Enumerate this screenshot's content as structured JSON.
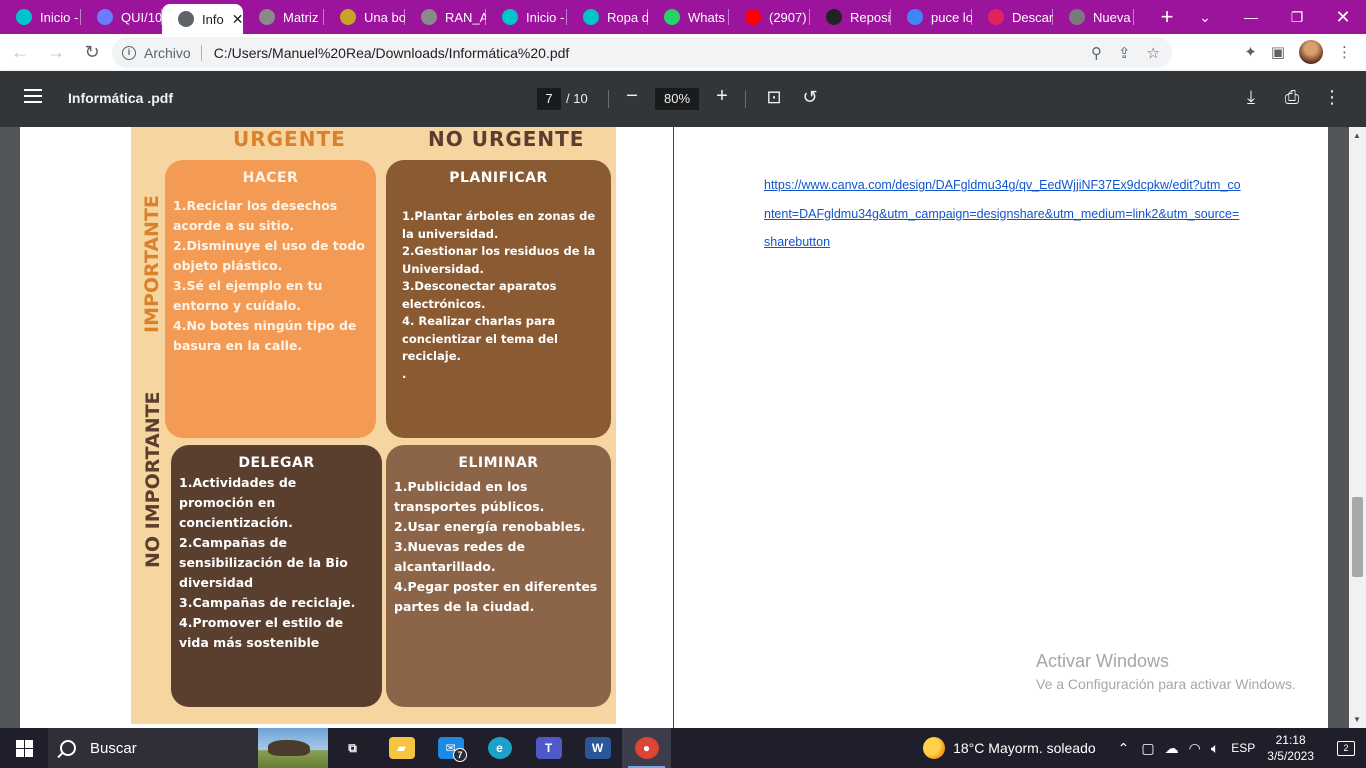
{
  "browser": {
    "tabs": [
      {
        "label": "Inicio -",
        "icon": "canva-icon",
        "color": "#00c4cc"
      },
      {
        "label": "QUI/10",
        "icon": "puzzle-icon",
        "color": "#6b7cff"
      },
      {
        "label": "Info",
        "icon": "chrome-doc-icon",
        "color": "#5f6368",
        "active": true
      },
      {
        "label": "Matriz",
        "icon": "site-icon",
        "color": "#8a8a8a"
      },
      {
        "label": "Una bo",
        "icon": "site-icon",
        "color": "#c9a227"
      },
      {
        "label": "RAN_A",
        "icon": "site-icon",
        "color": "#8a8a8a"
      },
      {
        "label": "Inicio -",
        "icon": "canva-icon",
        "color": "#00c4cc"
      },
      {
        "label": "Ropa d",
        "icon": "canva-icon",
        "color": "#00c4cc"
      },
      {
        "label": "Whats",
        "icon": "whatsapp-icon",
        "color": "#25d366"
      },
      {
        "label": "(2907)",
        "icon": "youtube-icon",
        "color": "#ff0000"
      },
      {
        "label": "Reposi",
        "icon": "d-icon",
        "color": "#222222"
      },
      {
        "label": "puce lo",
        "icon": "google-icon",
        "color": "#4285f4"
      },
      {
        "label": "Descar",
        "icon": "heart-icon",
        "color": "#e0245e"
      },
      {
        "label": "Nueva",
        "icon": "newtab-icon",
        "color": "#7a7a7a"
      }
    ],
    "address": {
      "security_label": "Archivo",
      "url": "C:/Users/Manuel%20Rea/Downloads/Informática%20.pdf"
    }
  },
  "pdf_toolbar": {
    "title": "Informática .pdf",
    "current_page": "7",
    "total_pages": "/ 10",
    "zoom": "80%"
  },
  "matrix": {
    "headers": {
      "urgent": "URGENTE",
      "not_urgent": "NO URGENTE"
    },
    "row_labels": {
      "important": "IMPORTANTE",
      "not_important": "NO IMPORTANTE"
    },
    "quadrants": {
      "hacer": {
        "title": "HACER",
        "items": [
          "1.Reciclar los desechos acorde a su sitio.",
          "2.Disminuye el uso de todo objeto plástico.",
          "3.Sé el ejemplo en tu entorno y cuídalo.",
          "4.No botes ningún tipo de basura en la calle."
        ]
      },
      "planificar": {
        "title": "PLANIFICAR",
        "items": [
          "1.Plantar árboles en zonas de la universidad.",
          "2.Gestionar los residuos de la Universidad.",
          "3.Desconectar aparatos electrónicos.",
          "4. Realizar charlas para concientizar el tema del reciclaje.",
          "."
        ]
      },
      "delegar": {
        "title": "DELEGAR",
        "items": [
          "1.Actividades de promoción en concientización.",
          "2.Campañas de sensibilización de la Bio diversidad",
          "3.Campañas de reciclaje.",
          "4.Promover el estilo de vida más sostenible"
        ]
      },
      "eliminar": {
        "title": "ELIMINAR",
        "items": [
          "1.Publicidad en los transportes públicos.",
          "2.Usar energía renobables.",
          "3.Nuevas redes de alcantarillado.",
          "4.Pegar poster en diferentes partes de la ciudad."
        ]
      }
    }
  },
  "link_text": "https://www.canva.com/design/DAFgldmu34g/qv_EedWjjiNF37Ex9dcpkw/edit?utm_content=DAFgldmu34g&utm_campaign=designshare&utm_medium=link2&utm_source=sharebutton",
  "watermark": {
    "line1": "Activar Windows",
    "line2": "Ve a Configuración para activar Windows."
  },
  "taskbar": {
    "search_placeholder": "Buscar",
    "apps": [
      {
        "name": "task-view-icon",
        "glyph": "⧉"
      },
      {
        "name": "file-explorer-icon",
        "glyph": "▰"
      },
      {
        "name": "mail-icon",
        "glyph": "✉"
      },
      {
        "name": "edge-icon",
        "glyph": "e"
      },
      {
        "name": "teams-icon",
        "glyph": "T"
      },
      {
        "name": "word-icon",
        "glyph": "W"
      },
      {
        "name": "chrome-icon",
        "glyph": "●"
      }
    ],
    "mail_badge": "7",
    "weather": "18°C  Mayorm. soleado",
    "language": "ESP",
    "time": "21:18",
    "date": "3/5/2023",
    "notifications": "2"
  },
  "colors": {
    "tabbar": "#9c139c",
    "hacer": "#f39a55",
    "planificar": "#8a5a33",
    "delegar": "#5a3e2e",
    "eliminar": "#8c6549",
    "header_text": "#d9822b",
    "row_label": "#d9822b",
    "row_label_dark": "#5a3e2e"
  }
}
